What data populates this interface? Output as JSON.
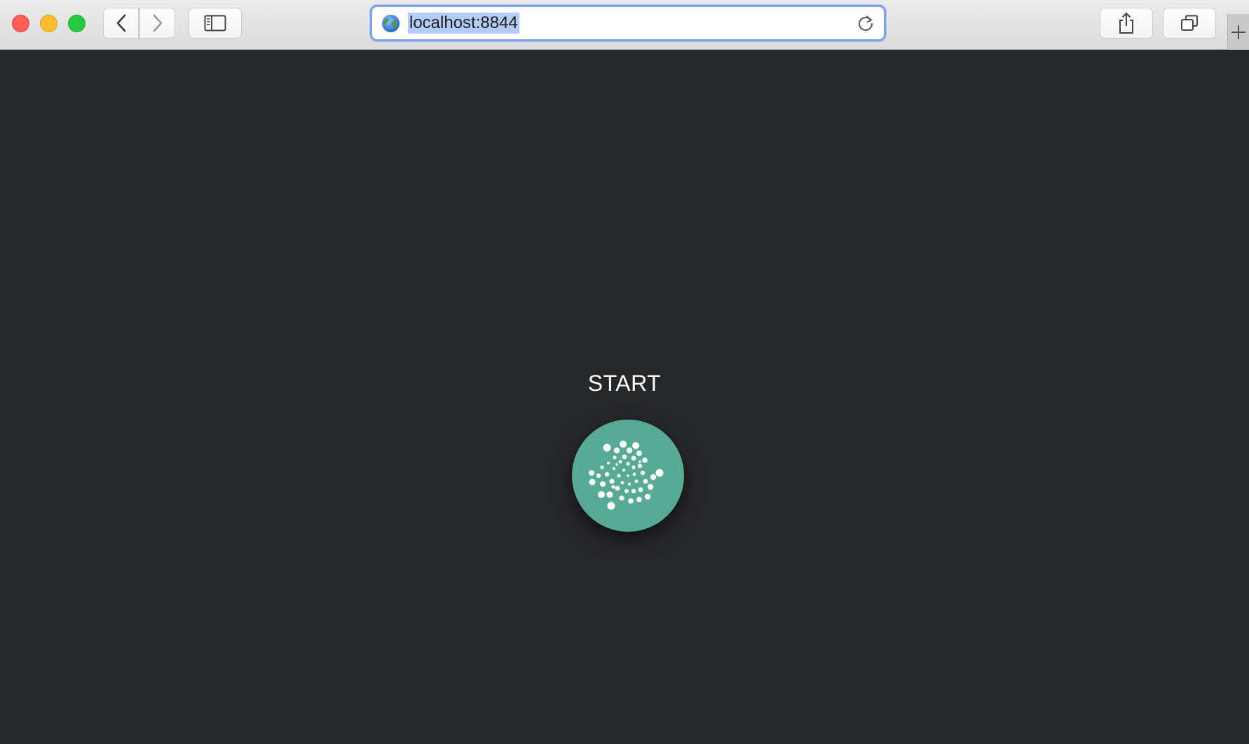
{
  "browser": {
    "address_bar": {
      "url": "localhost:8844"
    },
    "icons": {
      "back": "chevron-left-icon",
      "forward": "chevron-right-icon",
      "sidebar": "sidebar-icon",
      "share": "share-icon",
      "tabs": "tab-overview-icon",
      "reload": "reload-icon",
      "site": "globe-icon",
      "new_tab": "plus-icon"
    }
  },
  "page": {
    "start_label": "START",
    "logo": {
      "name": "iota-logo",
      "background_color": "#58aa95",
      "dot_color": "#ffffff"
    }
  },
  "colors": {
    "page_background": "#262729",
    "address_focus": "#7fa3e6",
    "url_selection": "#b3cdf7"
  }
}
